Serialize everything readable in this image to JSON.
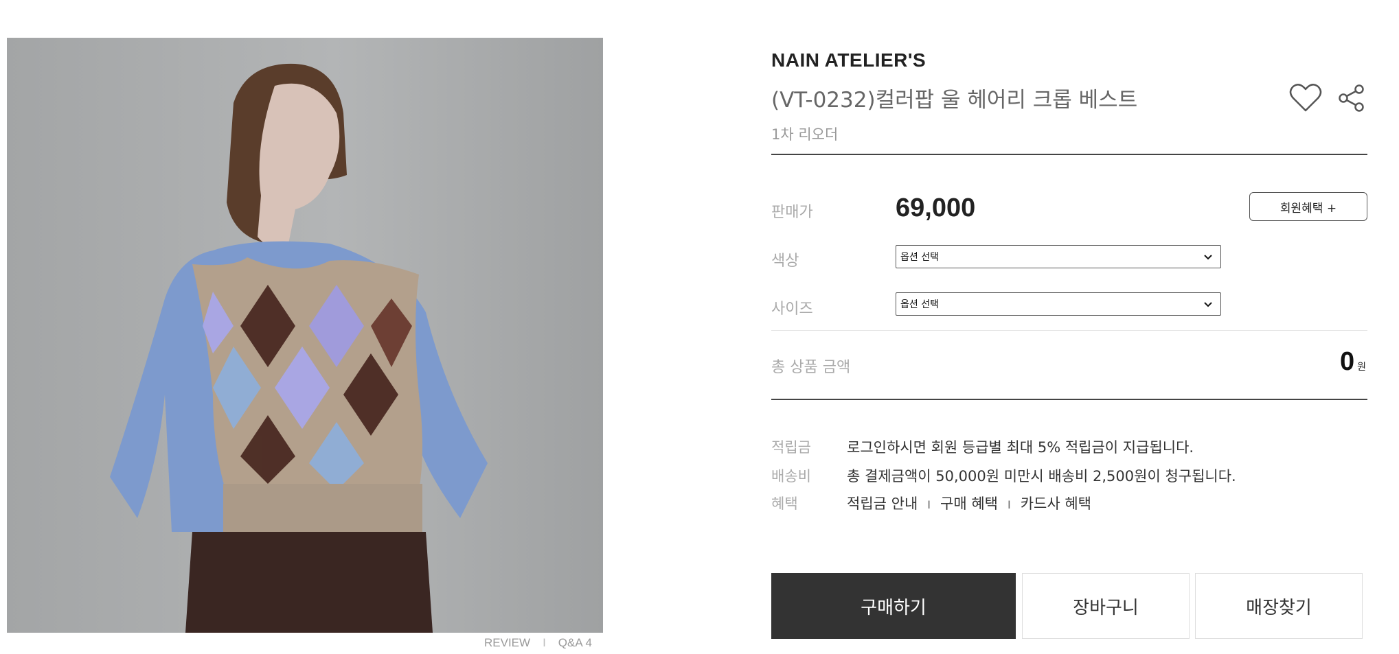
{
  "product": {
    "brand": "NAIN ATELIER'S",
    "name": "(VT-0232)컬러팝 울 헤어리 크롭 베스트",
    "note": "1차 리오더"
  },
  "image_links": {
    "review": "REVIEW",
    "separator": "I",
    "qna": "Q&A 4"
  },
  "pricing": {
    "price_label": "판매가",
    "price": "69,000",
    "member_benefit_button": "회원혜택 +"
  },
  "options": {
    "color_label": "색상",
    "color_select": "옵션 선택",
    "size_label": "사이즈",
    "size_select": "옵션 선택"
  },
  "total": {
    "label": "총 상품 금액",
    "value": "0",
    "unit": "원"
  },
  "info": {
    "points_label": "적립금",
    "points_text": "로그인하시면 회원 등급별 최대 5% 적립금이 지급됩니다.",
    "shipping_label": "배송비",
    "shipping_text": "총 결제금액이 50,000원 미만시 배송비 2,500원이 청구됩니다.",
    "benefits_label": "혜택",
    "benefit_links": [
      "적립금 안내",
      "구매 혜택",
      "카드사 혜택"
    ],
    "benefit_separator": "I"
  },
  "actions": {
    "buy": "구매하기",
    "cart": "장바구니",
    "store": "매장찾기"
  },
  "colors": {
    "buy_button_bg": "#333333",
    "rule": "#444444",
    "label_gray": "#aaaaaa"
  },
  "icons": {
    "like": "heart-icon",
    "share": "share-icon",
    "dropdown": "chevron-down-icon"
  }
}
